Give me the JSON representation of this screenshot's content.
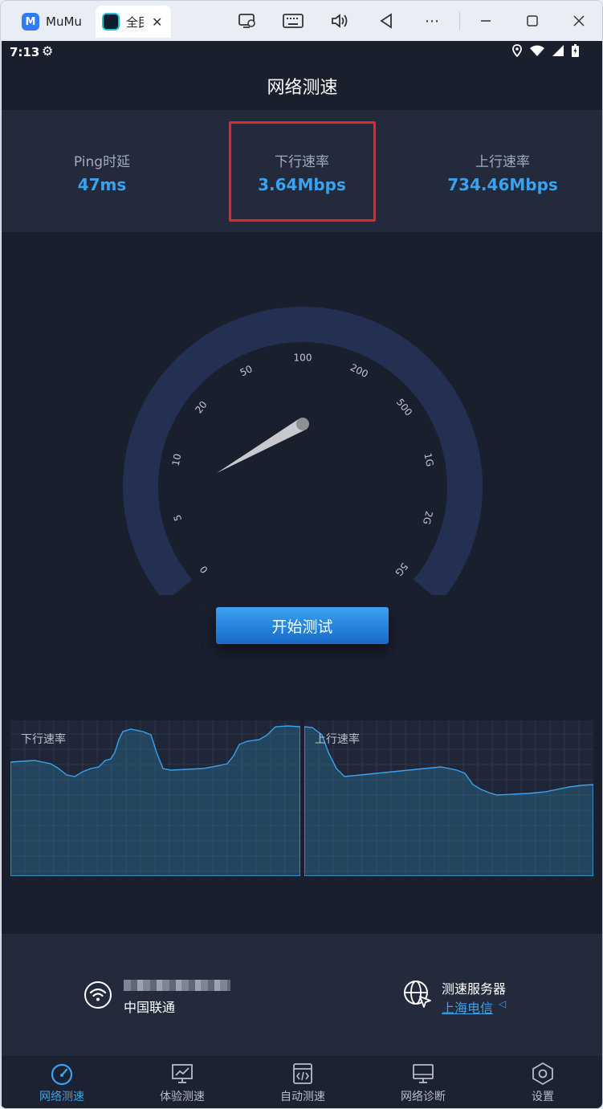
{
  "window": {
    "tabs": [
      {
        "label": "MuMu",
        "logo": "M"
      },
      {
        "label": "全民"
      }
    ],
    "controls": [
      "screen-record-icon",
      "keyboard-icon",
      "volume-icon",
      "back-icon",
      "more-icon",
      "minimize-icon",
      "maximize-icon",
      "close-icon"
    ]
  },
  "status_bar": {
    "time": "7:13"
  },
  "app": {
    "title": "网络测速",
    "stats": {
      "ping_label": "Ping时延",
      "ping_value": "47ms",
      "download_label": "下行速率",
      "download_value": "3.64Mbps",
      "upload_label": "上行速率",
      "upload_value": "734.46Mbps"
    },
    "gauge": {
      "ticks": [
        "0",
        "5",
        "10",
        "20",
        "50",
        "100",
        "200",
        "500",
        "1G",
        "2G",
        "5G"
      ],
      "needle_value_mbps": 3.64
    },
    "start_button": "开始测试",
    "charts": {
      "download_label": "下行速率",
      "upload_label": "上行速率"
    },
    "network": {
      "isp": "中国联通"
    },
    "server": {
      "title": "测速服务器",
      "name": "上海电信"
    },
    "nav": [
      {
        "label": "网络测速",
        "icon": "speedometer-icon",
        "active": true
      },
      {
        "label": "体验测速",
        "icon": "chart-monitor-icon",
        "active": false
      },
      {
        "label": "自动测速",
        "icon": "code-file-icon",
        "active": false
      },
      {
        "label": "网络诊断",
        "icon": "monitor-icon",
        "active": false
      },
      {
        "label": "设置",
        "icon": "settings-hexagon-icon",
        "active": false
      }
    ]
  },
  "colors": {
    "background": "#1a1f2e",
    "panel": "#222a3b",
    "accent": "#3aa2ef",
    "highlight_box": "#e5262b",
    "gauge_arc": "#243052"
  }
}
